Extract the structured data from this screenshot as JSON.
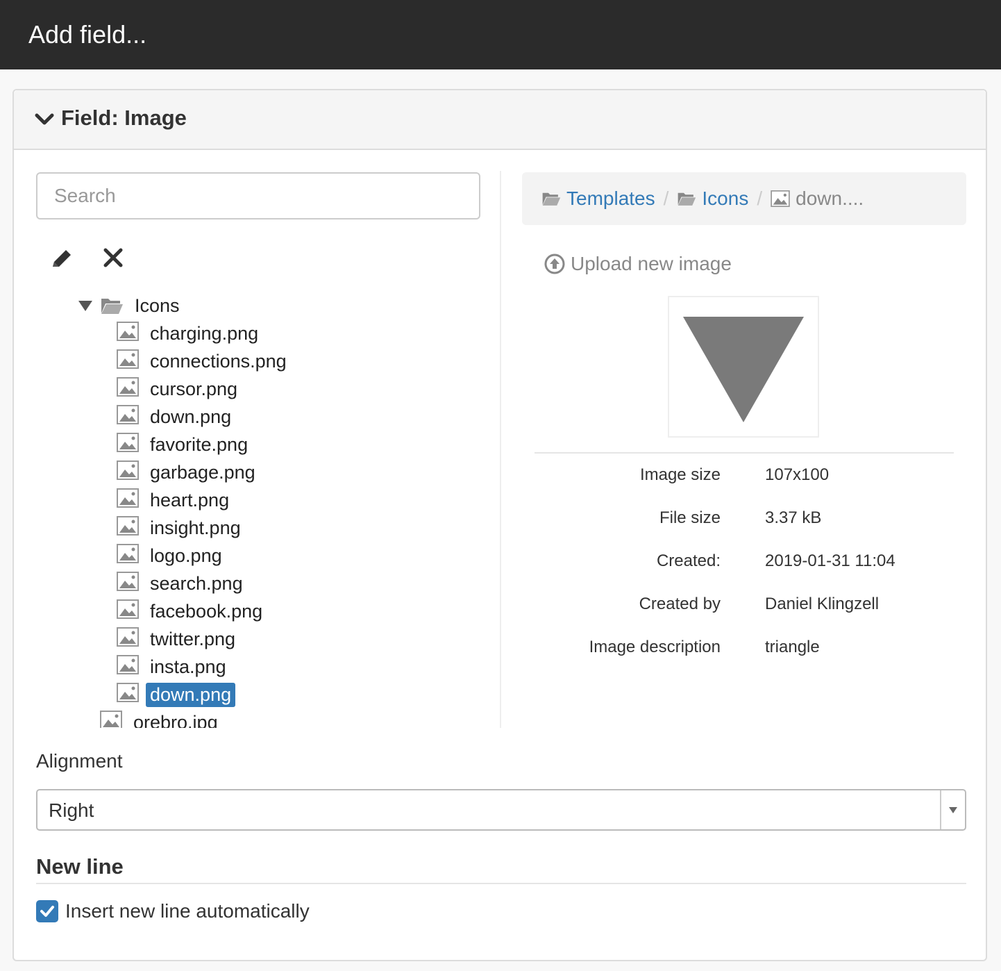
{
  "header": {
    "title": "Add field..."
  },
  "panel": {
    "title": "Field: Image"
  },
  "search": {
    "placeholder": "Search"
  },
  "tree": {
    "folder": "Icons",
    "children": [
      "charging.png",
      "connections.png",
      "cursor.png",
      "down.png",
      "favorite.png",
      "garbage.png",
      "heart.png",
      "insight.png",
      "logo.png",
      "search.png",
      "facebook.png",
      "twitter.png",
      "insta.png",
      "down.png"
    ],
    "selected_index": 13,
    "sibling": "orebro.jpg"
  },
  "breadcrumb": {
    "items": [
      "Templates",
      "Icons"
    ],
    "current": "down...."
  },
  "upload_label": "Upload new image",
  "properties": [
    {
      "label": "Image size",
      "value": "107x100"
    },
    {
      "label": "File size",
      "value": "3.37 kB"
    },
    {
      "label": "Created:",
      "value": "2019-01-31 11:04"
    },
    {
      "label": "Created by",
      "value": "Daniel Klingzell"
    },
    {
      "label": "Image description",
      "value": "triangle"
    }
  ],
  "alignment": {
    "label": "Alignment",
    "value": "Right"
  },
  "newline": {
    "title": "New line",
    "checkbox_label": "Insert new line automatically",
    "checked": true
  },
  "colors": {
    "accent": "#337ab7",
    "topbar": "#2b2b2b"
  }
}
